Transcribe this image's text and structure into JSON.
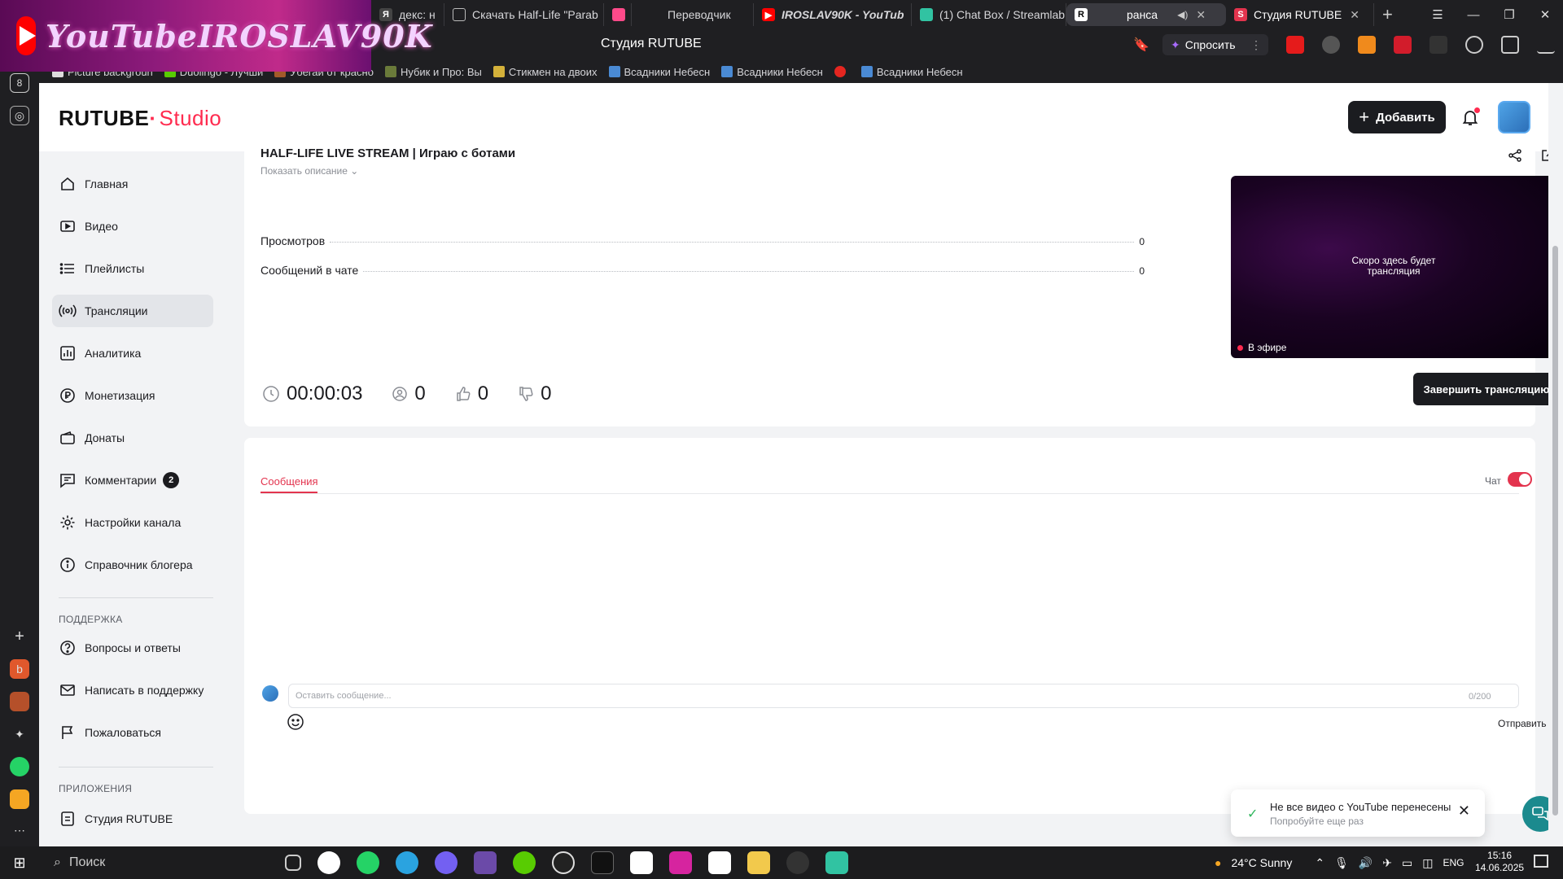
{
  "browser": {
    "overlay_channel_name": "YouTubeIROSLAV90K",
    "tabs": [
      {
        "label": "дeкс: н",
        "icon": "yandex-icon"
      },
      {
        "label": "Скачать Half-Life \"Parab",
        "icon": "document-icon"
      },
      {
        "label": "",
        "icon": "app-icon"
      },
      {
        "label": "Переводчик",
        "icon": "translate-icon"
      },
      {
        "label": "IROSLAV90K - YouTub",
        "icon": "youtube-icon"
      },
      {
        "label": "(1) Chat Box / Streamlab",
        "icon": "streamlabs-icon"
      },
      {
        "label": "ранса",
        "icon": "rutube-icon"
      },
      {
        "label": "Студия RUTUBE",
        "icon": "rutube-studio-icon"
      }
    ],
    "page_title": "Студия RUTUBE",
    "ask_label": "Спросить",
    "bookmarks": [
      "Picture backgroun",
      "Duolingo - Лучши",
      "Убегай от красно",
      "Нубик и Про: Вы",
      "Стикмен на двоих",
      "Всадники Небесн",
      "Всадники Небесн",
      "Я",
      "Всадники Небесн"
    ],
    "side_count_badge": "8"
  },
  "header": {
    "logo_rutube": "RUTUBE",
    "logo_studio": "Studio",
    "add_label": "Добавить"
  },
  "nav": {
    "items": [
      {
        "label": "Главная",
        "icon": "home-icon"
      },
      {
        "label": "Видео",
        "icon": "video-icon"
      },
      {
        "label": "Плейлисты",
        "icon": "playlist-icon"
      },
      {
        "label": "Трансляции",
        "icon": "broadcast-icon"
      },
      {
        "label": "Аналитика",
        "icon": "analytics-icon"
      },
      {
        "label": "Монетизация",
        "icon": "ruble-icon"
      },
      {
        "label": "Донаты",
        "icon": "wallet-icon"
      },
      {
        "label": "Комментарии",
        "icon": "comment-icon",
        "count": "2"
      },
      {
        "label": "Настройки канала",
        "icon": "gear-icon"
      },
      {
        "label": "Справочник блогера",
        "icon": "info-icon"
      }
    ],
    "support_heading": "ПОДДЕРЖКА",
    "support_items": [
      {
        "label": "Вопросы и ответы",
        "icon": "question-icon"
      },
      {
        "label": "Написать в поддержку",
        "icon": "mail-icon"
      },
      {
        "label": "Пожаловаться",
        "icon": "flag-icon"
      }
    ],
    "apps_heading": "ПРИЛОЖЕНИЯ",
    "apps_items": [
      {
        "label": "Студия RUTUBE",
        "icon": "studio-app-icon"
      }
    ]
  },
  "stream": {
    "title": "HALF-LIFE LIVE STREAM | Играю с ботами",
    "show_description": "Показать описание",
    "stats": [
      {
        "label": "Просмотров",
        "value": "0"
      },
      {
        "label": "Сообщений в чате",
        "value": "0"
      }
    ],
    "preview_soon_line1": "Скоро здесь будет",
    "preview_soon_line2": "трансляция",
    "live_label": "В эфире",
    "end_button": "Завершить трансляцию",
    "metrics": {
      "duration": "00:00:03",
      "viewers": "0",
      "likes": "0",
      "dislikes": "0"
    }
  },
  "chat": {
    "tab_label": "Сообщения",
    "toggle_label": "Чат",
    "toggle_on": true,
    "input_placeholder": "Оставить сообщение...",
    "counter": "0/200",
    "send_label": "Отправить"
  },
  "toast": {
    "title": "Не все видео с YouTube перенесены",
    "subtitle": "Попробуйте еще раз"
  },
  "taskbar": {
    "search_label": "Поиск",
    "weather": "24°C  Sunny",
    "lang": "ENG",
    "time": "15:16",
    "date": "14.06.2025"
  },
  "colors": {
    "accent": "#e3344e",
    "brand_red": "#ff2b4f",
    "dark_button": "#1b1c20",
    "page_bg": "#f2f3f5"
  }
}
